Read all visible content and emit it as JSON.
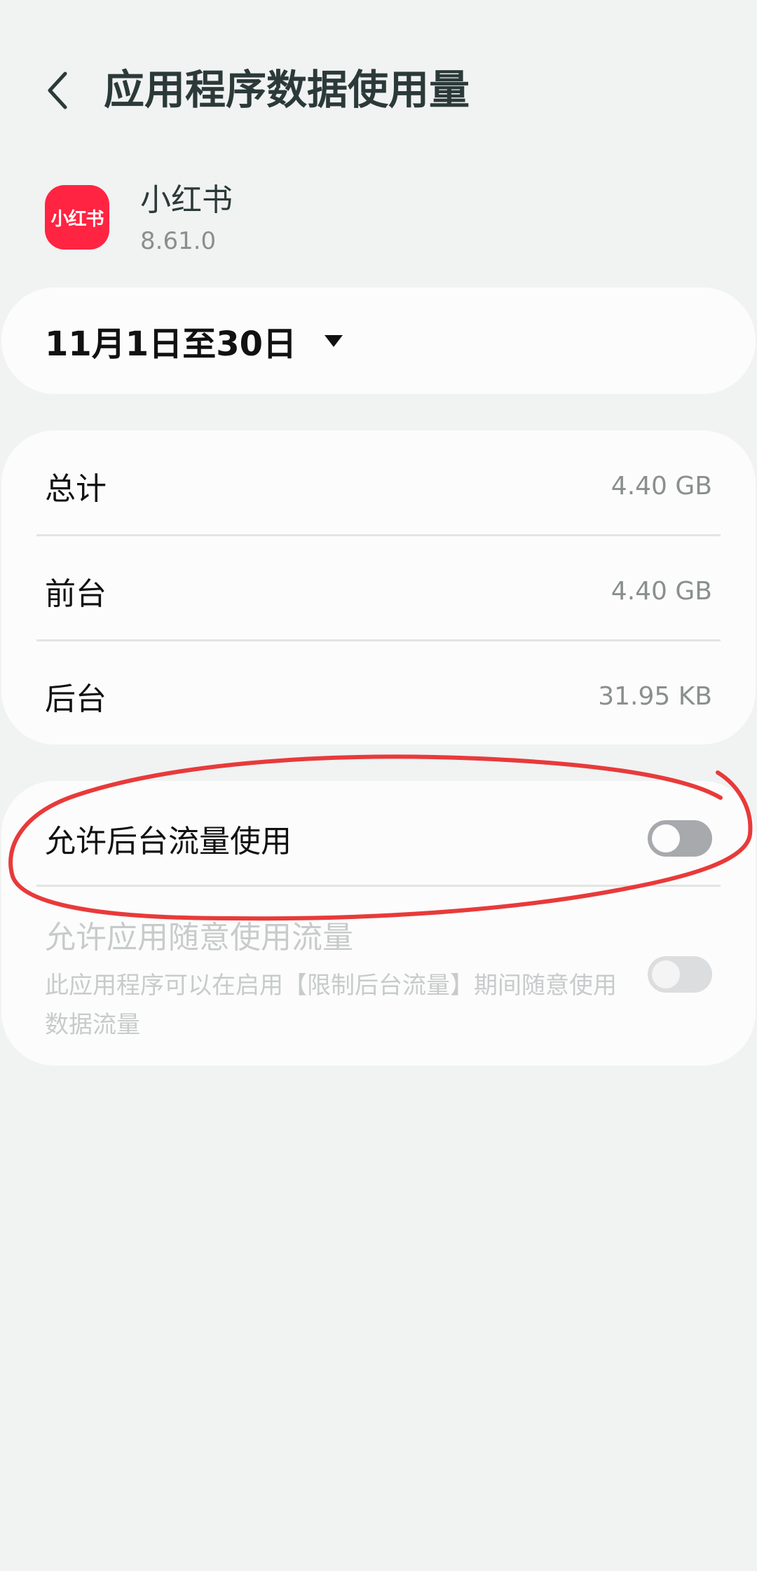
{
  "header": {
    "title": "应用程序数据使用量",
    "back_icon": "chevron-left-icon"
  },
  "app": {
    "icon_label": "小红书",
    "name": "小红书",
    "version": "8.61.0",
    "icon_color": "#ff2442"
  },
  "period": {
    "label": "11月1日至30日",
    "caret_icon": "caret-down-icon"
  },
  "usage": {
    "rows": [
      {
        "label": "总计",
        "value": "4.40 GB"
      },
      {
        "label": "前台",
        "value": "4.40 GB"
      },
      {
        "label": "后台",
        "value": "31.95 KB"
      }
    ]
  },
  "toggles": {
    "background_data": {
      "label": "允许后台流量使用",
      "enabled": false
    },
    "unrestricted_data": {
      "label": "允许应用随意使用流量",
      "description": "此应用程序可以在启用【限制后台流量】期间随意使用数据流量",
      "enabled": false,
      "disabled": true
    }
  },
  "annotation": {
    "type": "hand-drawn-circle",
    "color": "#e83a3a",
    "target": "允许后台流量使用"
  }
}
